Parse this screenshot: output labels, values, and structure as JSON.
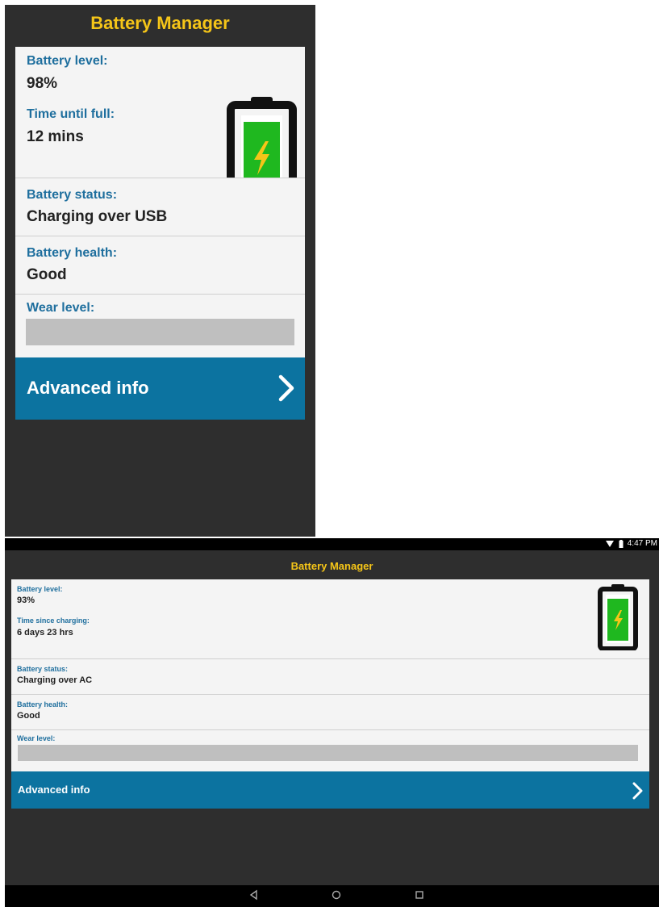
{
  "portrait": {
    "app_title": "Battery Manager",
    "battery_level_label": "Battery level:",
    "battery_level_value": "98%",
    "time_label": "Time until full:",
    "time_value": "12 mins",
    "status_label": "Battery status:",
    "status_value": "Charging over USB",
    "health_label": "Battery health:",
    "health_value": "Good",
    "wear_label": "Wear level:",
    "advanced_label": "Advanced info"
  },
  "landscape": {
    "status_time": "4:47 PM",
    "app_title": "Battery Manager",
    "battery_level_label": "Battery level:",
    "battery_level_value": "93%",
    "time_label": "Time since charging:",
    "time_value": "6 days 23 hrs",
    "status_label": "Battery status:",
    "status_value": "Charging over AC",
    "health_label": "Battery health:",
    "health_value": "Good",
    "wear_label": "Wear level:",
    "advanced_label": "Advanced info"
  },
  "icons": {
    "battery": "battery-charging-icon",
    "advanced": "chevron-right-icon",
    "wifi": "wifi-icon",
    "nav_back": "back-icon",
    "nav_home": "home-icon",
    "nav_recents": "recents-icon"
  },
  "colors": {
    "title_yellow": "#f5c518",
    "label_blue": "#1f6f9e",
    "advanced_bg": "#0c73a0",
    "battery_green": "#1fb81f",
    "background_dark": "#2e2e2e"
  }
}
